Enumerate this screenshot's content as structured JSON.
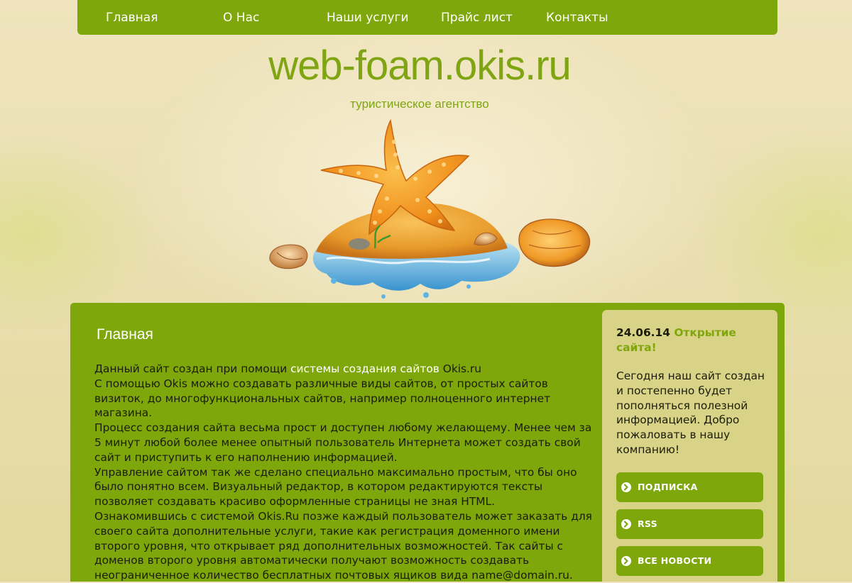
{
  "nav": {
    "items": [
      {
        "label": "Главная"
      },
      {
        "label": "О Нас"
      },
      {
        "label": "Наши услуги"
      },
      {
        "label": "Прайс лист"
      },
      {
        "label": "Контакты"
      }
    ]
  },
  "header": {
    "title": "web-foam.okis.ru",
    "subtitle": "туристическое агентство",
    "image_icon": "starfish-seashell-island"
  },
  "main": {
    "title": "Главная",
    "intro_prefix": "Данный сайт создан при помощи ",
    "intro_link": "системы создания сайтов",
    "intro_suffix": " Okis.ru",
    "paragraphs": [
      "С помощью Okis можно создавать различные виды сайтов, от простых сайтов визиток, до многофункциональных сайтов, например полноценного интернет магазина.",
      "Процесс создания сайта весьма прост и доступен любому желающему. Менее чем за 5 минут любой более менее опытный пользователь Интернета может создать свой сайт и приступить к его наполнению информацией.",
      "Управление сайтом так же сделано специально максимально простым, что бы оно было понятно всем. Визуальный редактор, в котором редактируются тексты позволяет создавать красиво оформленные страницы не зная HTML.",
      "Ознакомившись с системой Okis.Ru позже каждый пользователь может заказать для своего сайта дополнительные услуги, такие как регистрация доменного имени второго уровня, что открывает ряд дополнительных возможностей. Так сайты с доменов второго уровня автоматически получают возможность создавать неограниченное количество бесплатных почтовых ящиков вида name@domain.ru."
    ]
  },
  "sidebar": {
    "news_date": "24.06.14",
    "news_title": "Открытие сайта!",
    "news_text": "Сегодня наш сайт создан и постепенно будет пополняться полезной информацией. Добро пожаловать в нашу компанию!",
    "buttons": [
      {
        "label": "ПОДПИСКА",
        "icon": "arrow-circle-icon"
      },
      {
        "label": "RSS",
        "icon": "arrow-circle-icon"
      },
      {
        "label": "ВСЕ НОВОСТИ",
        "icon": "arrow-circle-icon"
      }
    ]
  },
  "colors": {
    "accent_green": "#7ea70b",
    "sidebar_bg": "#d9d387",
    "title_green": "#7fa512"
  }
}
